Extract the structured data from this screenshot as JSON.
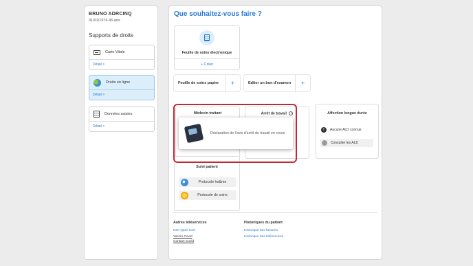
{
  "patient": {
    "name": "BRUNO ADRCINQ",
    "dob_age": "01/01/1976 45 ans"
  },
  "supports": {
    "title": "Supports de droits",
    "cards": [
      {
        "label": "Carte Vitale",
        "link": "Détail  >",
        "icon": "card-icon"
      },
      {
        "label": "Droits en ligne",
        "link": "Détail  >",
        "icon": "globe-icon"
      },
      {
        "label": "Données saisies",
        "link": "Détail  >",
        "icon": "document-icon"
      }
    ]
  },
  "main": {
    "title": "Que souhaitez-vous faire ?",
    "fse": {
      "title": "Feuille de soins électronique",
      "create": "+ Créer"
    },
    "fsp": {
      "label": "Feuille de soins papier",
      "plus": "+"
    },
    "ebe": {
      "label": "Editer un bon d'examen",
      "plus": "+"
    },
    "medecin": {
      "title": "Médecin traitant"
    },
    "arret": {
      "title": "Arrêt de travail",
      "info": "i"
    },
    "tooltip": {
      "text": "Déclaration de l'avis d'arrêt de travail en cours"
    },
    "ald": {
      "title": "Affection longue durée",
      "row1": "Aucune ALD connue",
      "row1_icon": "!",
      "row2": "Consulter les ALD"
    },
    "suivi": {
      "title": "Suivi patient",
      "row1": "Protocole ho&me",
      "row2": "Protocole de soins"
    },
    "footer": {
      "col1_title": "Autres téléservices",
      "col1_links": [
        "DrE Appel INSi",
        "Vaccin Covid",
        "Contact Covid"
      ],
      "col2_title": "Historiques du patient",
      "col2_links": [
        "Historique des factures",
        "Historique des téléservices"
      ]
    }
  },
  "colors": {
    "accent": "#2a7ad0",
    "highlight": "#c3272f",
    "active_card": "#ddeefb"
  }
}
